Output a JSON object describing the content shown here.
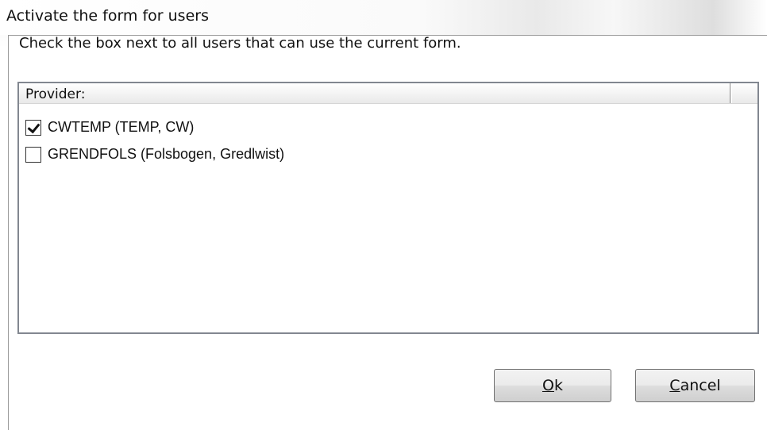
{
  "window": {
    "title": "Activate the form for users"
  },
  "instruction": "Check the box next to all users that can use the current form.",
  "list": {
    "column_header": "Provider:",
    "items": [
      {
        "label": "CWTEMP (TEMP, CW)",
        "checked": true
      },
      {
        "label": "GRENDFOLS (Folsbogen, Gredlwist)",
        "checked": false
      }
    ]
  },
  "buttons": {
    "ok": {
      "mnemonic": "O",
      "rest": "k"
    },
    "cancel": {
      "mnemonic": "C",
      "rest": "ancel"
    }
  }
}
